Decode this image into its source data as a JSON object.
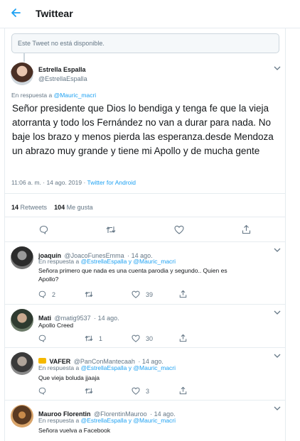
{
  "header": {
    "title": "Twittear"
  },
  "unavailable_text": "Este Tweet no está disponible.",
  "main_tweet": {
    "name": "Estrella Espalla",
    "handle": "@EstrellaEspalla",
    "reply_prefix": "En respuesta a",
    "reply_to": "@Mauric_macri",
    "text": "Señor presidente que Dios lo bendiga y tenga fe que la vieja atorranta y todo los Fernández no van a durar para nada. No baje los brazo y menos pierda las esperanza.desde Mendoza un abrazo muy grande y tiene mi Apollo y de mucha gente",
    "time": "11:06 a. m. · 14 ago. 2019 ·",
    "source": "Twitter for Android",
    "retweets_count": "14",
    "retweets_label": "Retweets",
    "likes_count": "104",
    "likes_label": "Me gusta"
  },
  "replies": [
    {
      "name": "joaquín",
      "handle": "@JoacoFunesEmma",
      "date": "· 14 ago.",
      "reply_prefix": "En respuesta a",
      "reply_to": "@EstrellaEspalla y @Mauric_macri",
      "text_line1": "Señora primero que nada es una cuenta parodia y segundo.. Quien es",
      "text_line2": "Apollo?",
      "replies_count": "2",
      "retweets_count": "",
      "likes_count": "39"
    },
    {
      "name": "Mati",
      "handle": "@matig9537",
      "date": "· 14 ago.",
      "text_line1": "Apollo Creed",
      "replies_count": "",
      "retweets_count": "1",
      "likes_count": "30"
    },
    {
      "name": "VAFER",
      "handle": "@PanConMantecaah",
      "date": "· 14 ago.",
      "reply_prefix": "En respuesta a",
      "reply_to": "@EstrellaEspalla y @Mauric_macri",
      "text_line1": "Que vieja boluda jjaaja",
      "replies_count": "",
      "retweets_count": "",
      "likes_count": "3"
    },
    {
      "name": "Mauroo Florentin",
      "handle": "@FlorentinMauroo",
      "date": "· 14 ago.",
      "reply_prefix": "En respuesta a",
      "reply_to": "@EstrellaEspalla y @Mauric_macri",
      "text_line1": "Señora vuelva a Facebook"
    }
  ],
  "colors": {
    "accent": "#1da1f2",
    "text": "#14171a",
    "muted": "#657786",
    "border": "#e6ecf0"
  }
}
